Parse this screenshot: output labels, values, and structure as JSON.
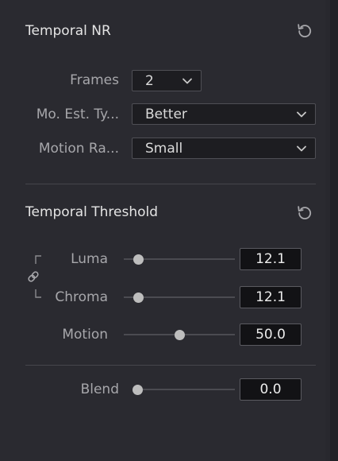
{
  "temporal_nr": {
    "title": "Temporal NR",
    "frames": {
      "label": "Frames",
      "value": "2"
    },
    "motion_estimation_type": {
      "label": "Mo. Est. Ty...",
      "value": "Better"
    },
    "motion_range": {
      "label": "Motion Ra...",
      "value": "Small"
    }
  },
  "temporal_threshold": {
    "title": "Temporal Threshold",
    "luma": {
      "label": "Luma",
      "value": "12.1",
      "slider_fraction": 0.13
    },
    "chroma": {
      "label": "Chroma",
      "value": "12.1",
      "slider_fraction": 0.13
    },
    "motion": {
      "label": "Motion",
      "value": "50.0",
      "slider_fraction": 0.5
    },
    "blend": {
      "label": "Blend",
      "value": "0.0",
      "slider_fraction": 0.0
    }
  },
  "icons": {
    "reset": "reset-icon",
    "link": "link-icon",
    "dropdown": "chevron-down-icon"
  },
  "colors": {
    "panel_bg": "#2a2a30",
    "field_bg": "#1d1d21",
    "thumb": "#bdbdbd",
    "label_text": "#a7a7ab"
  }
}
